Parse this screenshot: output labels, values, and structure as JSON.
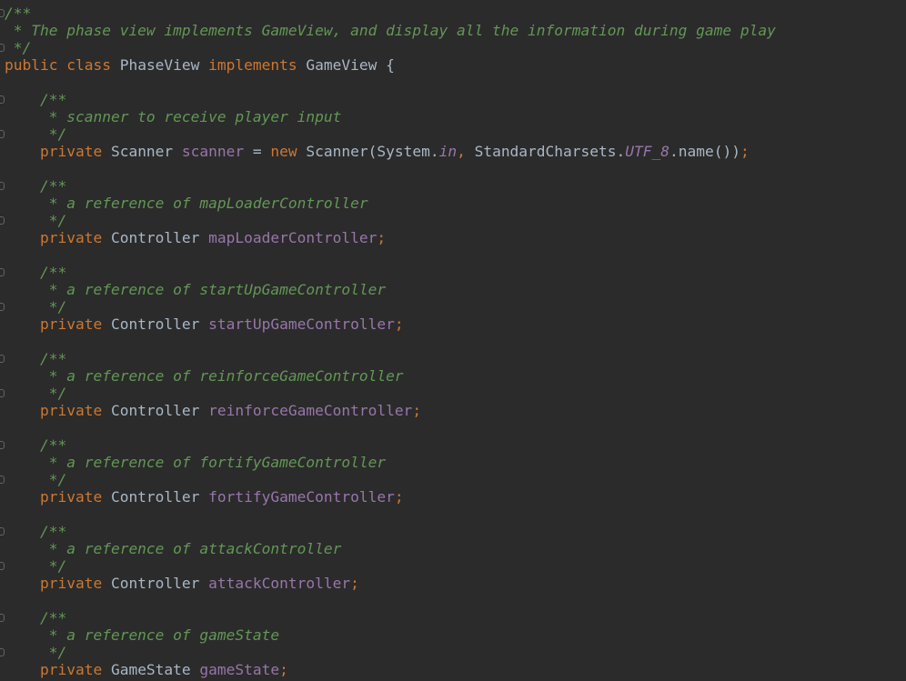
{
  "editor": {
    "language": "java",
    "theme_colors": {
      "background": "#2b2b2b",
      "comment": "#629755",
      "keyword": "#cc7832",
      "text": "#a9b7c6",
      "field": "#9876aa"
    },
    "lines": [
      {
        "tokens": [
          {
            "type": "doc",
            "text": "/**"
          }
        ]
      },
      {
        "tokens": [
          {
            "type": "doc",
            "text": " * The phase view implements GameView, and display all the information during game play"
          }
        ]
      },
      {
        "tokens": [
          {
            "type": "doc",
            "text": " */"
          }
        ]
      },
      {
        "tokens": [
          {
            "type": "kw",
            "text": "public class "
          },
          {
            "type": "plain",
            "text": "PhaseView "
          },
          {
            "type": "kw",
            "text": "implements "
          },
          {
            "type": "plain",
            "text": "GameView {"
          }
        ]
      },
      {
        "tokens": []
      },
      {
        "tokens": [
          {
            "type": "doc",
            "text": "    /**"
          }
        ]
      },
      {
        "tokens": [
          {
            "type": "doc",
            "text": "     * scanner to receive player input"
          }
        ]
      },
      {
        "tokens": [
          {
            "type": "doc",
            "text": "     */"
          }
        ]
      },
      {
        "tokens": [
          {
            "type": "kw",
            "text": "    private "
          },
          {
            "type": "plain",
            "text": "Scanner "
          },
          {
            "type": "field",
            "text": "scanner"
          },
          {
            "type": "plain",
            "text": " = "
          },
          {
            "type": "kw",
            "text": "new "
          },
          {
            "type": "plain",
            "text": "Scanner(System."
          },
          {
            "type": "static",
            "text": "in"
          },
          {
            "type": "punct",
            "text": ", "
          },
          {
            "type": "plain",
            "text": "StandardCharsets."
          },
          {
            "type": "static",
            "text": "UTF_8"
          },
          {
            "type": "plain",
            "text": ".name())"
          },
          {
            "type": "punct",
            "text": ";"
          }
        ]
      },
      {
        "tokens": []
      },
      {
        "tokens": [
          {
            "type": "doc",
            "text": "    /**"
          }
        ]
      },
      {
        "tokens": [
          {
            "type": "doc",
            "text": "     * a reference of mapLoaderController"
          }
        ]
      },
      {
        "tokens": [
          {
            "type": "doc",
            "text": "     */"
          }
        ]
      },
      {
        "tokens": [
          {
            "type": "kw",
            "text": "    private "
          },
          {
            "type": "plain",
            "text": "Controller "
          },
          {
            "type": "field",
            "text": "mapLoaderController"
          },
          {
            "type": "punct",
            "text": ";"
          }
        ]
      },
      {
        "tokens": []
      },
      {
        "tokens": [
          {
            "type": "doc",
            "text": "    /**"
          }
        ]
      },
      {
        "tokens": [
          {
            "type": "doc",
            "text": "     * a reference of startUpGameController"
          }
        ]
      },
      {
        "tokens": [
          {
            "type": "doc",
            "text": "     */"
          }
        ]
      },
      {
        "tokens": [
          {
            "type": "kw",
            "text": "    private "
          },
          {
            "type": "plain",
            "text": "Controller "
          },
          {
            "type": "field",
            "text": "startUpGameController"
          },
          {
            "type": "punct",
            "text": ";"
          }
        ]
      },
      {
        "tokens": []
      },
      {
        "tokens": [
          {
            "type": "doc",
            "text": "    /**"
          }
        ]
      },
      {
        "tokens": [
          {
            "type": "doc",
            "text": "     * a reference of reinforceGameController"
          }
        ]
      },
      {
        "tokens": [
          {
            "type": "doc",
            "text": "     */"
          }
        ]
      },
      {
        "tokens": [
          {
            "type": "kw",
            "text": "    private "
          },
          {
            "type": "plain",
            "text": "Controller "
          },
          {
            "type": "field",
            "text": "reinforceGameController"
          },
          {
            "type": "punct",
            "text": ";"
          }
        ]
      },
      {
        "tokens": []
      },
      {
        "tokens": [
          {
            "type": "doc",
            "text": "    /**"
          }
        ]
      },
      {
        "tokens": [
          {
            "type": "doc",
            "text": "     * a reference of fortifyGameController"
          }
        ]
      },
      {
        "tokens": [
          {
            "type": "doc",
            "text": "     */"
          }
        ]
      },
      {
        "tokens": [
          {
            "type": "kw",
            "text": "    private "
          },
          {
            "type": "plain",
            "text": "Controller "
          },
          {
            "type": "field",
            "text": "fortifyGameController"
          },
          {
            "type": "punct",
            "text": ";"
          }
        ]
      },
      {
        "tokens": []
      },
      {
        "tokens": [
          {
            "type": "doc",
            "text": "    /**"
          }
        ]
      },
      {
        "tokens": [
          {
            "type": "doc",
            "text": "     * a reference of attackController"
          }
        ]
      },
      {
        "tokens": [
          {
            "type": "doc",
            "text": "     */"
          }
        ]
      },
      {
        "tokens": [
          {
            "type": "kw",
            "text": "    private "
          },
          {
            "type": "plain",
            "text": "Controller "
          },
          {
            "type": "field",
            "text": "attackController"
          },
          {
            "type": "punct",
            "text": ";"
          }
        ]
      },
      {
        "tokens": []
      },
      {
        "tokens": [
          {
            "type": "doc",
            "text": "    /**"
          }
        ]
      },
      {
        "tokens": [
          {
            "type": "doc",
            "text": "     * a reference of gameState"
          }
        ]
      },
      {
        "tokens": [
          {
            "type": "doc",
            "text": "     */"
          }
        ]
      },
      {
        "tokens": [
          {
            "type": "kw",
            "text": "    private "
          },
          {
            "type": "plain",
            "text": "GameState "
          },
          {
            "type": "field",
            "text": "gameState"
          },
          {
            "type": "punct",
            "text": ";"
          }
        ]
      }
    ]
  }
}
